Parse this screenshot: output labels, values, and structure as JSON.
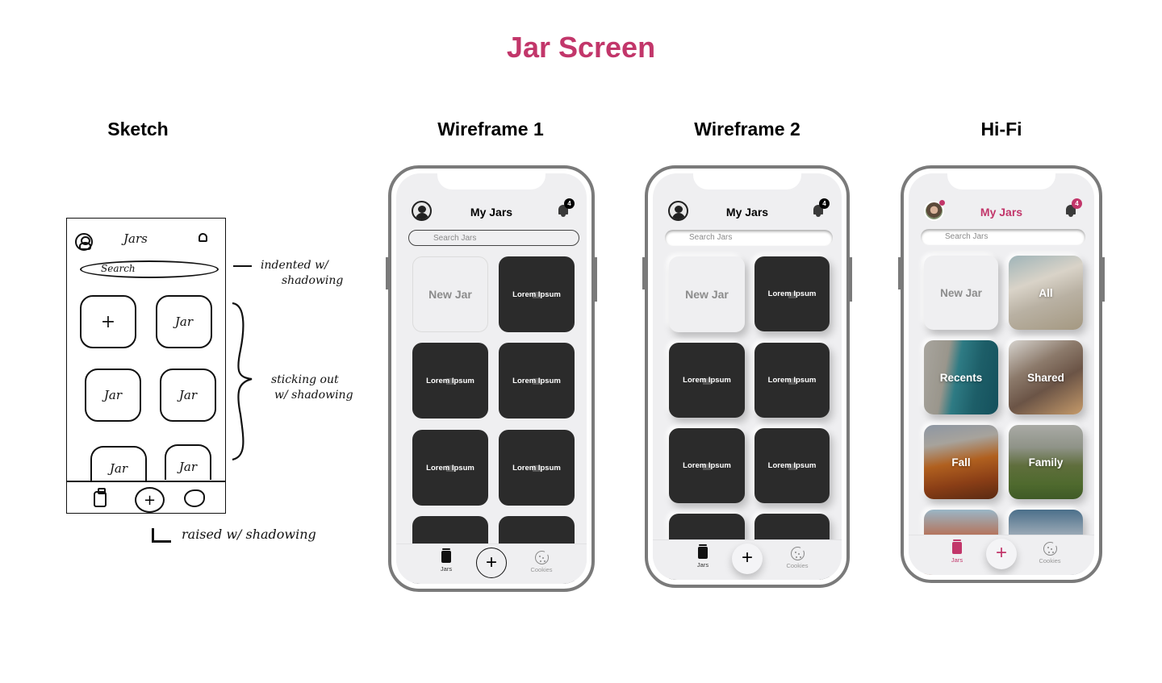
{
  "page_title": "Jar Screen",
  "columns": {
    "sketch": "Sketch",
    "wireframe1": "Wireframe 1",
    "wireframe2": "Wireframe 2",
    "hifi": "Hi-Fi"
  },
  "sketch": {
    "header_title": "Jars",
    "search_label": "Search",
    "new_card_symbol": "+",
    "jar_label": "Jar",
    "nav_plus": "+",
    "notes": {
      "search": [
        "indented w/",
        "shadowing"
      ],
      "cards": [
        "sticking out",
        "w/ shadowing"
      ],
      "nav": "raised w/ shadowing"
    }
  },
  "app": {
    "title": "My Jars",
    "notification_count": "4",
    "search_placeholder": "Search Jars",
    "new_jar_label": "New Jar",
    "placeholder_label": "Lorem Ipsum",
    "tabs": {
      "jars": "Jars",
      "add": "+",
      "cookies": "Cookies"
    }
  },
  "hifi": {
    "jars": [
      {
        "label": "All"
      },
      {
        "label": "Recents"
      },
      {
        "label": "Shared"
      },
      {
        "label": "Fall"
      },
      {
        "label": "Family"
      }
    ]
  },
  "colors": {
    "accent": "#c2366a",
    "dark_card": "#2b2b2b",
    "screen_bg": "#efeff1",
    "frame": "#7a7a7a"
  }
}
